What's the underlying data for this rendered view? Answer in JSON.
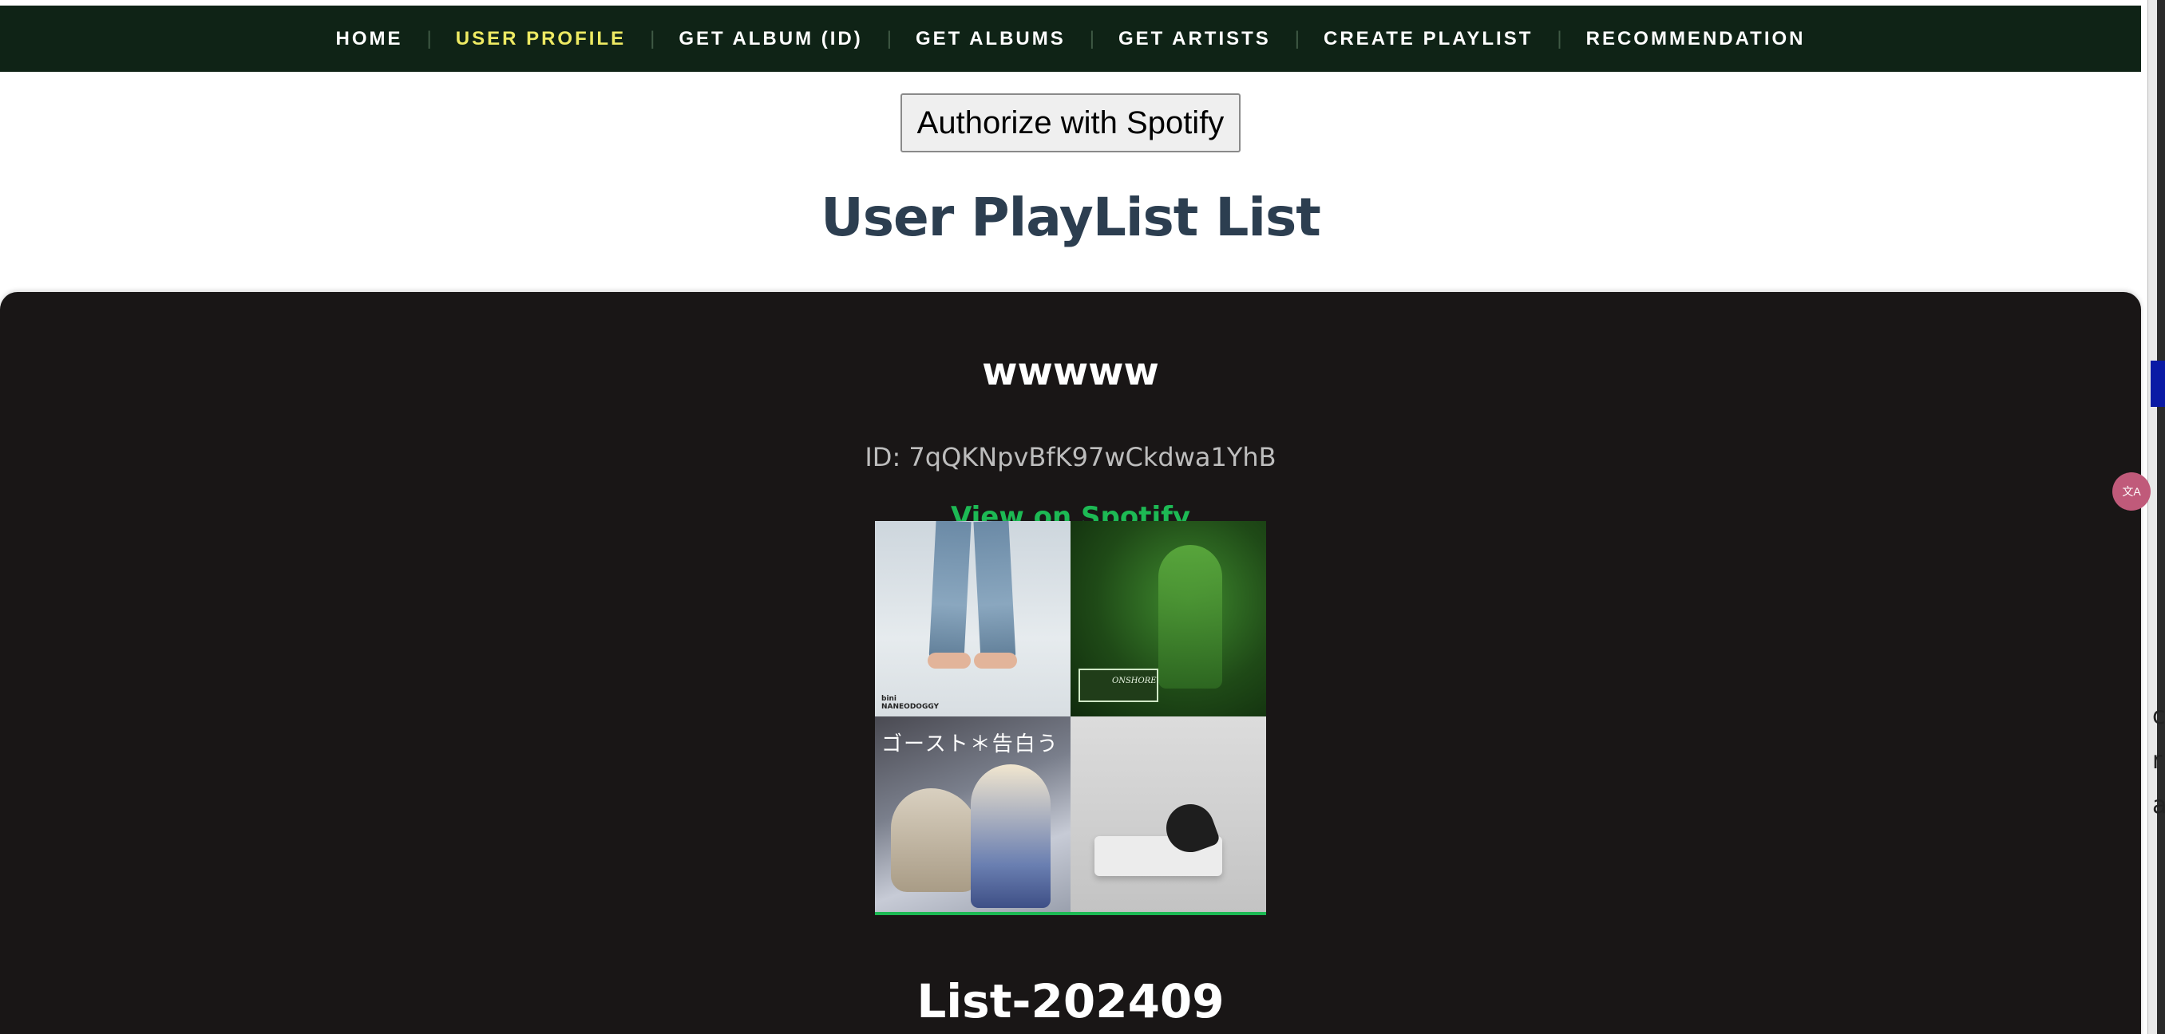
{
  "nav": {
    "items": [
      {
        "label": "HOME",
        "active": false
      },
      {
        "label": "USER PROFILE",
        "active": true
      },
      {
        "label": "GET ALBUM (ID)",
        "active": false
      },
      {
        "label": "GET ALBUMS",
        "active": false
      },
      {
        "label": "GET ARTISTS",
        "active": false
      },
      {
        "label": "CREATE PLAYLIST",
        "active": false
      },
      {
        "label": "RECOMMENDATION",
        "active": false
      }
    ],
    "separator": "|",
    "colors": {
      "background": "#0f2316",
      "active": "#eeea63",
      "text": "#ffffff"
    }
  },
  "auth": {
    "button_label": "Authorize with Spotify"
  },
  "page": {
    "title": "User PlayList List"
  },
  "playlists": [
    {
      "name": "wwwww",
      "id_text": "ID: 7qQKNpvBfK97wCkdwa1YhB",
      "link_label": "View on Spotify",
      "cover_caption": "bini\nNANEODOGGY",
      "cover_text_jp": "ゴースト＊告白う"
    },
    {
      "name": "List-202409"
    }
  ],
  "colors": {
    "panel": "#191616",
    "spotify_green": "#1db954",
    "title": "#2c3e50"
  },
  "side": {
    "letters": [
      "c",
      "r",
      "a"
    ]
  }
}
